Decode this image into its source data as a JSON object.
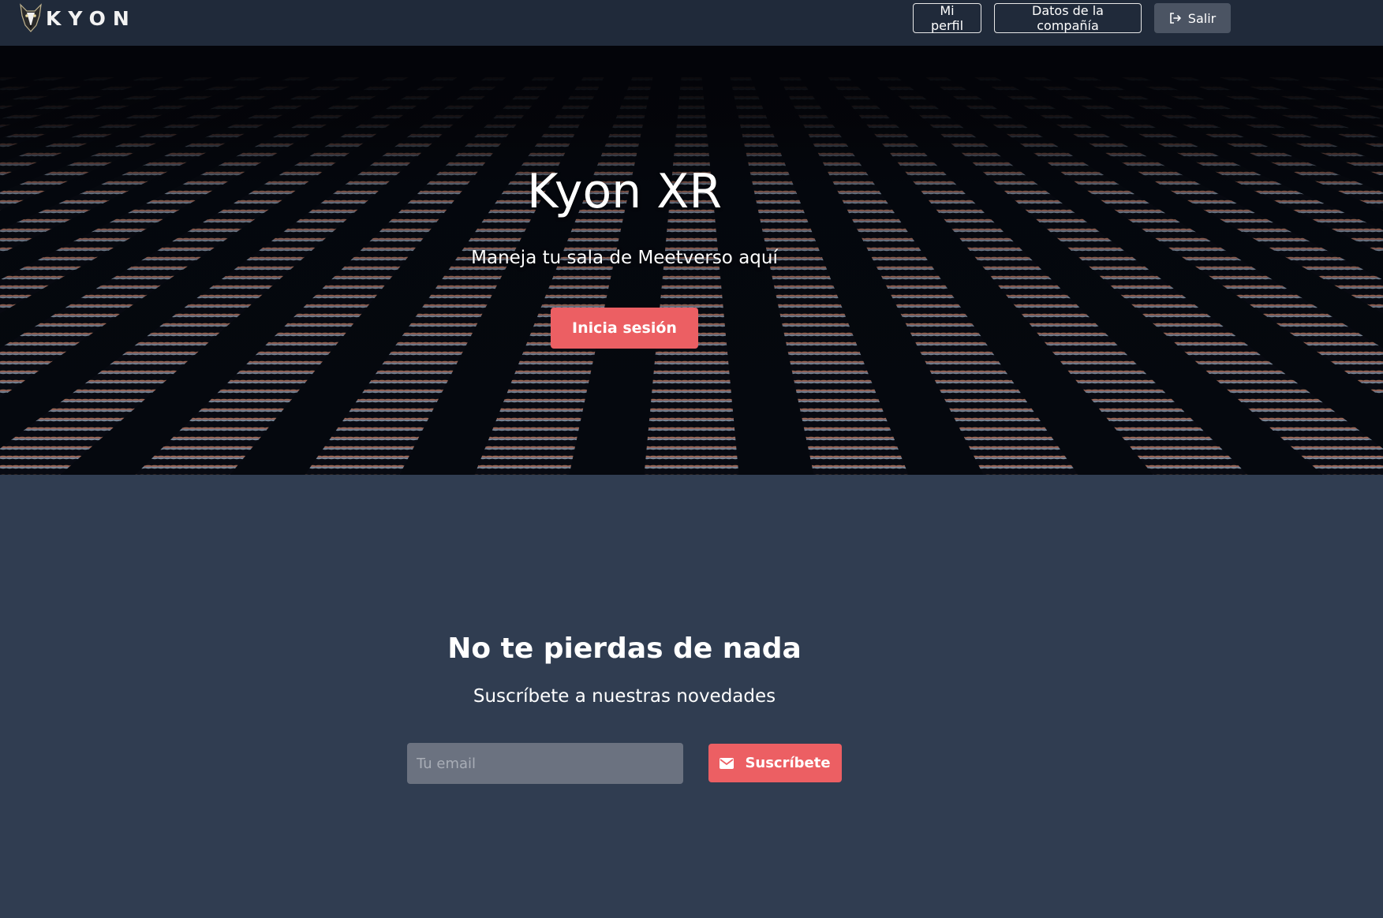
{
  "navbar": {
    "brand_text": "KYON",
    "profile_label": "Mi perfil",
    "company_label": "Datos de la compañía",
    "logout_label": "Salir"
  },
  "hero": {
    "title": "Kyon XR",
    "subtitle": "Maneja tu sala de Meetverso aquí",
    "cta_label": "Inicia sesión"
  },
  "subscribe": {
    "title": "No te pierdas de nada",
    "subtitle": "Suscríbete a nuestras novedades",
    "email_placeholder": "Tu email",
    "button_label": "Suscríbete"
  },
  "colors": {
    "navbar_bg": "#202a3a",
    "page_bg": "#303d51",
    "accent": "#ec5f63",
    "logout_bg": "#4b5463",
    "input_bg": "#6b7280"
  },
  "icons": {
    "brand_logo": "dog-head-logo",
    "logout": "sign-out-icon",
    "subscribe": "envelope-icon"
  }
}
